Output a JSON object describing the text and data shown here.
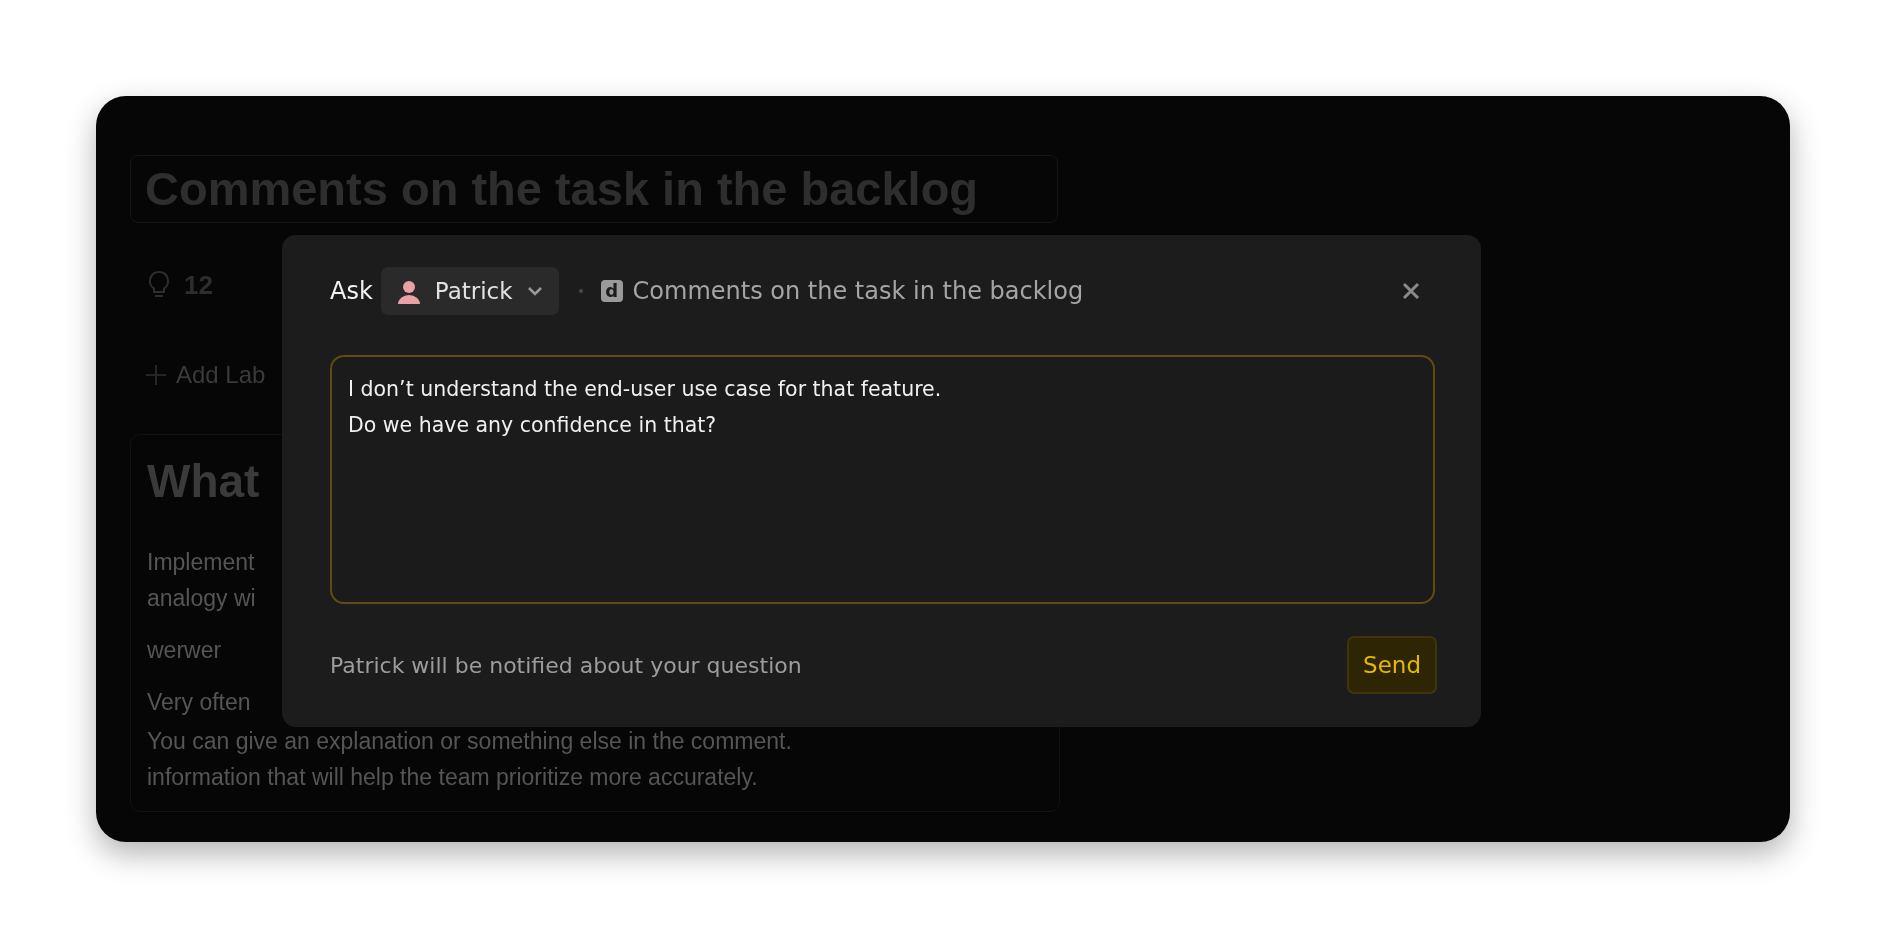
{
  "background": {
    "title": "Comments on the task in the backlog",
    "count": "12",
    "add_label": "Add Lab",
    "heading": "What",
    "paragraphs": [
      "Implement",
      "analogy wi",
      "werwer",
      "Very often",
      "You can give an explanation or something else in the comment.",
      "information that will help the team prioritize more accurately."
    ]
  },
  "dialog": {
    "ask_label": "Ask",
    "assignee": "Patrick",
    "doc_badge": "d",
    "doc_title": "Comments on the task in the backlog",
    "message": {
      "value": "I don’t understand the end-user use case for that feature.\nDo we have any confidence in that?",
      "focused": true
    },
    "hint": "Patrick will be notified about your question",
    "send": "Send"
  }
}
